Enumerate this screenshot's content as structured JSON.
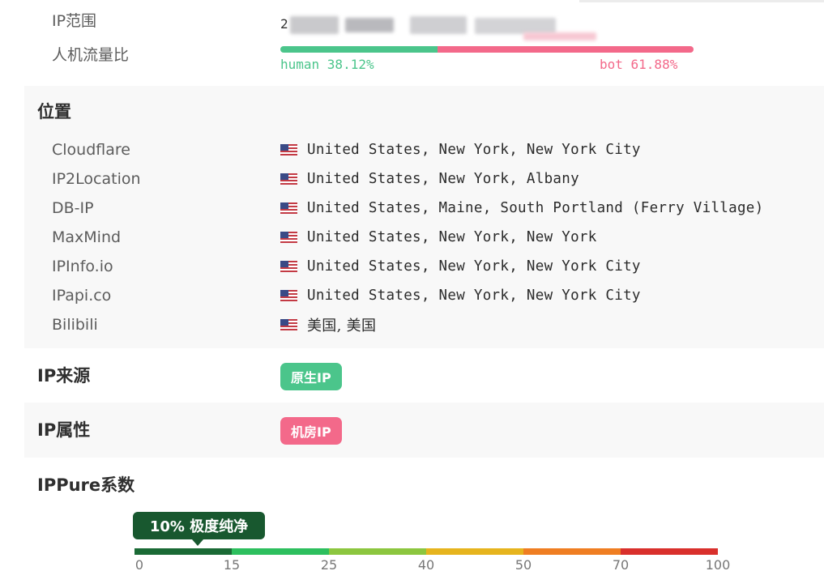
{
  "ip_range": {
    "label": "IP范围",
    "value_visible_prefix": "2"
  },
  "traffic_ratio": {
    "label": "人机流量比",
    "human_text": "human 38.12%",
    "bot_text": "bot 61.88%",
    "human_fraction": 0.3812,
    "bot_fraction": 0.6188,
    "human_color": "#4bc58b",
    "bot_color": "#f3698a"
  },
  "location": {
    "heading": "位置",
    "flag_icon": "us-flag-icon",
    "rows": [
      {
        "source": "Cloudflare",
        "value": "United States, New York, New York City"
      },
      {
        "source": "IP2Location",
        "value": "United States, New York, Albany"
      },
      {
        "source": "DB-IP",
        "value": "United States, Maine, South Portland (Ferry Village)"
      },
      {
        "source": "MaxMind",
        "value": "United States, New York, New York"
      },
      {
        "source": "IPInfo.io",
        "value": "United States, New York, New York City"
      },
      {
        "source": "IPapi.co",
        "value": "United States, New York, New York City"
      },
      {
        "source": "Bilibili",
        "value": "美国, 美国"
      }
    ]
  },
  "ip_source": {
    "heading": "IP来源",
    "badge": "原生IP",
    "badge_color": "#4bc58b"
  },
  "ip_attribute": {
    "heading": "IP属性",
    "badge": "机房IP",
    "badge_color": "#f3698a"
  },
  "purity": {
    "heading": "IPPure系数",
    "value_percent": 10,
    "tooltip": "10% 极度纯净",
    "tooltip_color": "#18582f",
    "ticks": [
      "0",
      "15",
      "25",
      "40",
      "50",
      "70",
      "100"
    ],
    "segments": [
      {
        "from": 0,
        "to": 15,
        "color": "#1a6a35"
      },
      {
        "from": 15,
        "to": 25,
        "color": "#2dbf5e"
      },
      {
        "from": 25,
        "to": 40,
        "color": "#8cc63f"
      },
      {
        "from": 40,
        "to": 50,
        "color": "#e6b41e"
      },
      {
        "from": 50,
        "to": 70,
        "color": "#ef7e22"
      },
      {
        "from": 70,
        "to": 100,
        "color": "#d9302c"
      }
    ]
  }
}
